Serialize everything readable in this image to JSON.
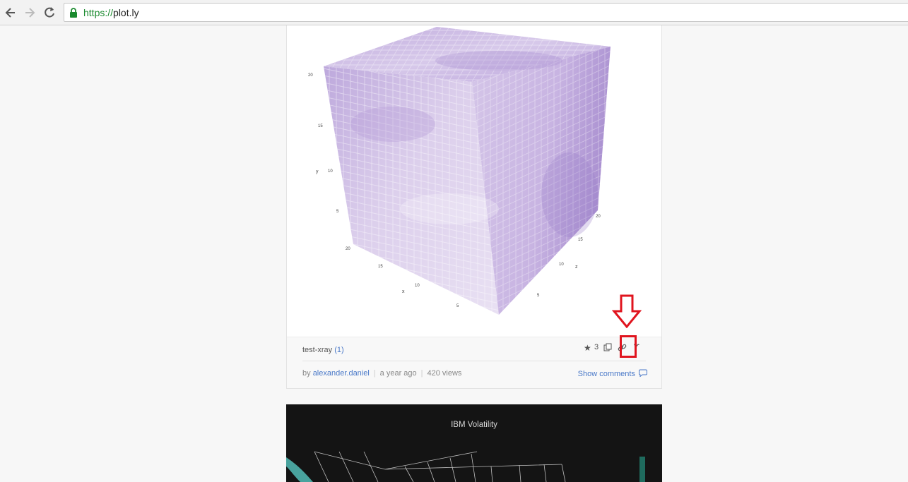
{
  "browser": {
    "url_scheme": "https://",
    "url_host": "plot.ly"
  },
  "plot1": {
    "title": "test-xray",
    "version": "(1)",
    "stars": "3",
    "author_prefix": "by",
    "author": "alexander.daniel",
    "age": "a year ago",
    "views": "420 views",
    "show_comments": "Show comments",
    "axis": {
      "y_label": "y",
      "x_label": "x",
      "z_label": "z",
      "y_ticks": [
        "20",
        "15",
        "10",
        "5"
      ],
      "x_ticks": [
        "20",
        "15",
        "10",
        "5"
      ],
      "z_ticks": [
        "20",
        "15",
        "10",
        "5"
      ]
    },
    "colors": {
      "light": "#e6dcf0",
      "mid": "#c9b6e0",
      "dark": "#a98fd0"
    }
  },
  "plot2": {
    "title": "IBM Volatility"
  },
  "icons": {
    "back": "arrow-left-icon",
    "forward": "arrow-right-icon",
    "reload": "reload-icon",
    "lock": "lock-icon",
    "star": "star-icon",
    "fork": "copy-icon",
    "share": "link-icon",
    "python": "python-icon",
    "comment": "comment-icon",
    "annotation": "down-arrow-annotation-icon"
  }
}
